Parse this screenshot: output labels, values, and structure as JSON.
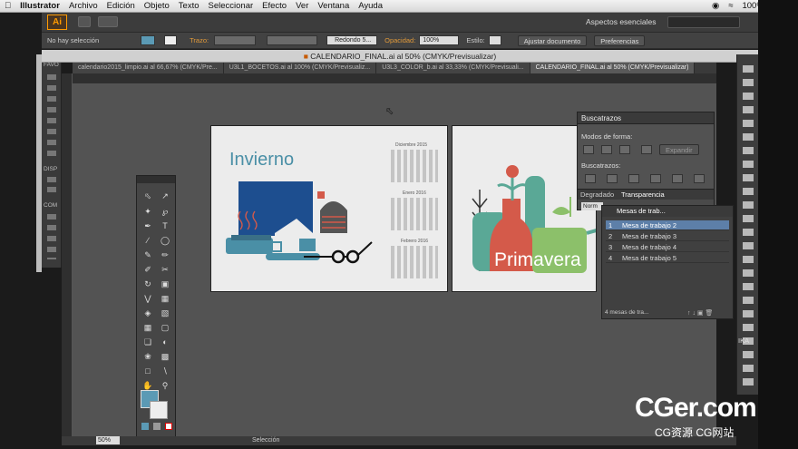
{
  "menubar": {
    "app": "Illustrator",
    "items": [
      "Archivo",
      "Edición",
      "Objeto",
      "Texto",
      "Seleccionar",
      "Efecto",
      "Ver",
      "Ventana",
      "Ayuda"
    ],
    "battery": "100%",
    "workspace": "Aspectos esenciales"
  },
  "appbar": {
    "logo": "Ai"
  },
  "control": {
    "selection": "No hay selección",
    "trazo_label": "Trazo:",
    "brush": "Redondo 5...",
    "opacidad_label": "Opacidad:",
    "opacidad_value": "100%",
    "estilo_label": "Estilo:",
    "ajustar": "Ajustar documento",
    "preferencias": "Preferencias"
  },
  "document": {
    "title": "CALENDARIO_FINAL.ai al 50% (CMYK/Previsualizar)"
  },
  "tabs": [
    {
      "label": "calendario2015_limpio.ai al 66,67% (CMYK/Pre..."
    },
    {
      "label": "U3L1_BOCETOS.ai al 100% (CMYK/Previsualiz..."
    },
    {
      "label": "U3L3_COLOR_b.ai al 33,33% (CMYK/Previsuali..."
    },
    {
      "label": "CALENDARIO_FINAL.ai al 50% (CMYK/Previsualizar)"
    }
  ],
  "left_panel_labels": [
    "FAVO",
    "DISP",
    "COM"
  ],
  "artboard1": {
    "title": "Invierno",
    "months": [
      "Diciembre 2015",
      "Enero 2016",
      "Febrero 2016"
    ]
  },
  "artboard2": {
    "title": "Primavera"
  },
  "buscatrazos": {
    "title": "Buscatrazos",
    "modos": "Modos de forma:",
    "expandir": "Expandir",
    "buscatrazos_label": "Buscatrazos:"
  },
  "subtabs": {
    "degradado": "Degradado",
    "transparencia": "Transparencia",
    "normal": "Norm"
  },
  "mesas": {
    "title": "Mesas de trab...",
    "rows": [
      {
        "num": "1",
        "name": "Mesa de trabajo 2"
      },
      {
        "num": "2",
        "name": "Mesa de trabajo 3"
      },
      {
        "num": "3",
        "name": "Mesa de trabajo 4"
      },
      {
        "num": "4",
        "name": "Mesa de trabajo 5"
      }
    ],
    "footer": "4 mesas de tra..."
  },
  "status": {
    "zoom": "50%",
    "mode": "Selección",
    "side_text": "IKA"
  },
  "watermark": {
    "line1": "CGer.com",
    "line2": "CG资源 CG网站"
  },
  "colors": {
    "accent_orange": "#ff9a00",
    "blue": "#1d4e8f",
    "teal": "#4a8fa6",
    "coral": "#d45a4a",
    "green": "#5aa896"
  }
}
